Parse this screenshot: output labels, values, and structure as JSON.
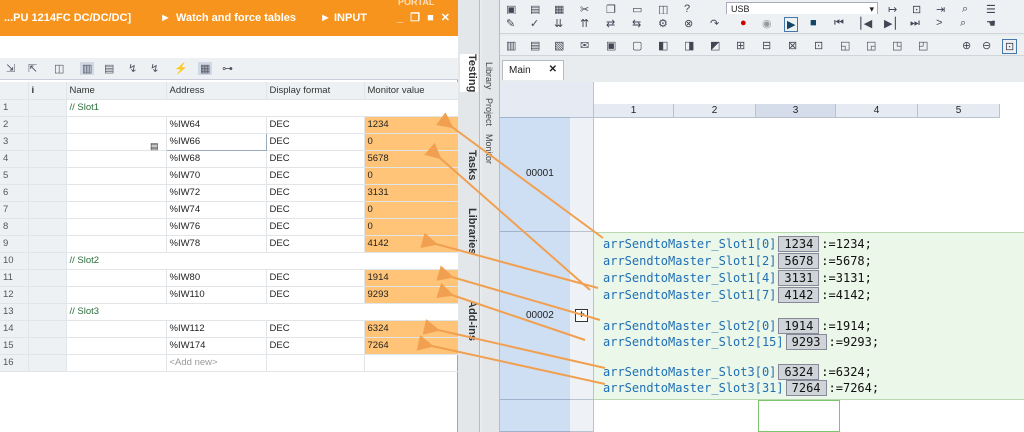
{
  "left_panel": {
    "title_part1": "...PU 1214FC DC/DC/DC]",
    "title_part2": "Watch and force tables",
    "title_part3": "INPUT",
    "window_controls": "_ ❐ ■ ✕",
    "brand_partial": "PORTAL",
    "columns": [
      "i",
      "Name",
      "Address",
      "Display format",
      "Monitor value"
    ],
    "rows": [
      {
        "n": "1",
        "type": "slot",
        "label": "// Slot1"
      },
      {
        "n": "2",
        "address": "%IW64",
        "format": "DEC",
        "value": "1234"
      },
      {
        "n": "3",
        "address": "%IW66",
        "format": "DEC",
        "value": "0"
      },
      {
        "n": "4",
        "address": "%IW68",
        "format": "DEC",
        "value": "5678"
      },
      {
        "n": "5",
        "address": "%IW70",
        "format": "DEC",
        "value": "0"
      },
      {
        "n": "6",
        "address": "%IW72",
        "format": "DEC",
        "value": "3131"
      },
      {
        "n": "7",
        "address": "%IW74",
        "format": "DEC",
        "value": "0"
      },
      {
        "n": "8",
        "address": "%IW76",
        "format": "DEC",
        "value": "0"
      },
      {
        "n": "9",
        "address": "%IW78",
        "format": "DEC",
        "value": "4142"
      },
      {
        "n": "10",
        "type": "slot",
        "label": "// Slot2"
      },
      {
        "n": "11",
        "address": "%IW80",
        "format": "DEC",
        "value": "1914"
      },
      {
        "n": "12",
        "address": "%IW110",
        "format": "DEC",
        "value": "9293"
      },
      {
        "n": "13",
        "type": "slot",
        "label": "// Slot3"
      },
      {
        "n": "14",
        "address": "%IW112",
        "format": "DEC",
        "value": "6324"
      },
      {
        "n": "15",
        "address": "%IW174",
        "format": "DEC",
        "value": "7264"
      },
      {
        "n": "16",
        "type": "add",
        "label": "<Add new>"
      }
    ]
  },
  "side_tabs": [
    "Testing",
    "Tasks",
    "Libraries",
    "Add-ins"
  ],
  "right_panel": {
    "side_tabs": [
      "Library",
      "Project",
      "Monitor"
    ],
    "connection": "USB",
    "editor_tab": "Main",
    "close_glyph": "✕",
    "columns": [
      "1",
      "2",
      "3",
      "4",
      "5"
    ],
    "networks": [
      "00001",
      "00002"
    ],
    "code_lines": [
      {
        "var": "arrSendtoMaster_Slot1[0]",
        "box": "1234",
        "rest": ":=1234;"
      },
      {
        "var": "arrSendtoMaster_Slot1[2]",
        "box": "5678",
        "rest": ":=5678;"
      },
      {
        "var": "arrSendtoMaster_Slot1[4]",
        "box": "3131",
        "rest": ":=3131;"
      },
      {
        "var": "arrSendtoMaster_Slot1[7]",
        "box": "4142",
        "rest": ":=4142;"
      },
      {
        "var": "arrSendtoMaster_Slot2[0]",
        "box": "1914",
        "rest": ":=1914;"
      },
      {
        "var": "arrSendtoMaster_Slot2[15]",
        "box": "9293",
        "rest": ":=9293;"
      },
      {
        "var": "arrSendtoMaster_Slot3[0]",
        "box": "6324",
        "rest": ":=6324;"
      },
      {
        "var": "arrSendtoMaster_Slot3[31]",
        "box": "7264",
        "rest": ":=7264;"
      }
    ]
  },
  "colors": {
    "accent": "#f7941d",
    "monitor_cell": "#ffc477",
    "arrow": "#f0a050",
    "code_var": "#1f6fb5"
  },
  "icons": [
    "monitor-all-icon",
    "monitor-now-icon",
    "modify-icon",
    "force-icon",
    "usb-dropdown-icon",
    "play-icon",
    "stop-icon",
    "zoom-in-icon",
    "zoom-out-icon"
  ]
}
